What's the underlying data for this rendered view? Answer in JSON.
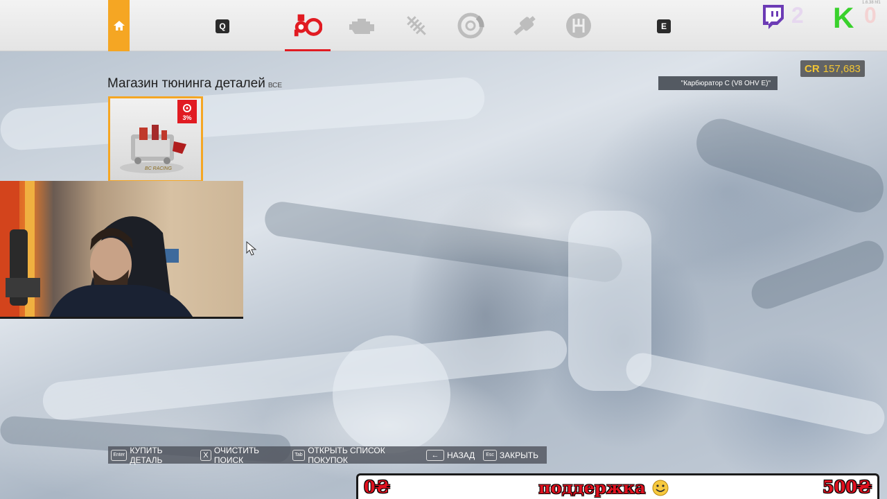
{
  "topbar": {
    "home_icon": "home-icon",
    "key_left": "Q",
    "key_right": "E",
    "categories": [
      {
        "icon": "turbo-icon",
        "active": true
      },
      {
        "icon": "engine-icon",
        "active": false
      },
      {
        "icon": "suspension-icon",
        "active": false
      },
      {
        "icon": "brake-icon",
        "active": false
      },
      {
        "icon": "exhaust-icon",
        "active": false
      },
      {
        "icon": "gearbox-icon",
        "active": false
      }
    ],
    "active_color": "#e11b22",
    "accent_color": "#f5a623"
  },
  "overlay": {
    "twitch_count": "2",
    "k_label": "K",
    "k_count": "0",
    "version": "1.6.38 hf1"
  },
  "credits": {
    "label": "CR",
    "value": "157,683"
  },
  "search": {
    "query": "\"Карбюратор C (V8 OHV E)\""
  },
  "shop": {
    "title": "Магазин тюнинга деталей",
    "filter": "все"
  },
  "part": {
    "discount": "3%",
    "brand": "BC RACING"
  },
  "hints": [
    {
      "key": "Enter",
      "label": "КУПИТЬ ДЕТАЛЬ"
    },
    {
      "key": "X",
      "label": "ОЧИСТИТЬ ПОИСК"
    },
    {
      "key": "Tab",
      "label": "ОТКРЫТЬ СПИСОК ПОКУПОК"
    },
    {
      "key": "←",
      "label": "НАЗАД"
    },
    {
      "key": "Esc",
      "label": "ЗАКРЫТЬ"
    }
  ],
  "banner": {
    "left": "0₴",
    "center": "поддержка",
    "right": "500₴"
  }
}
